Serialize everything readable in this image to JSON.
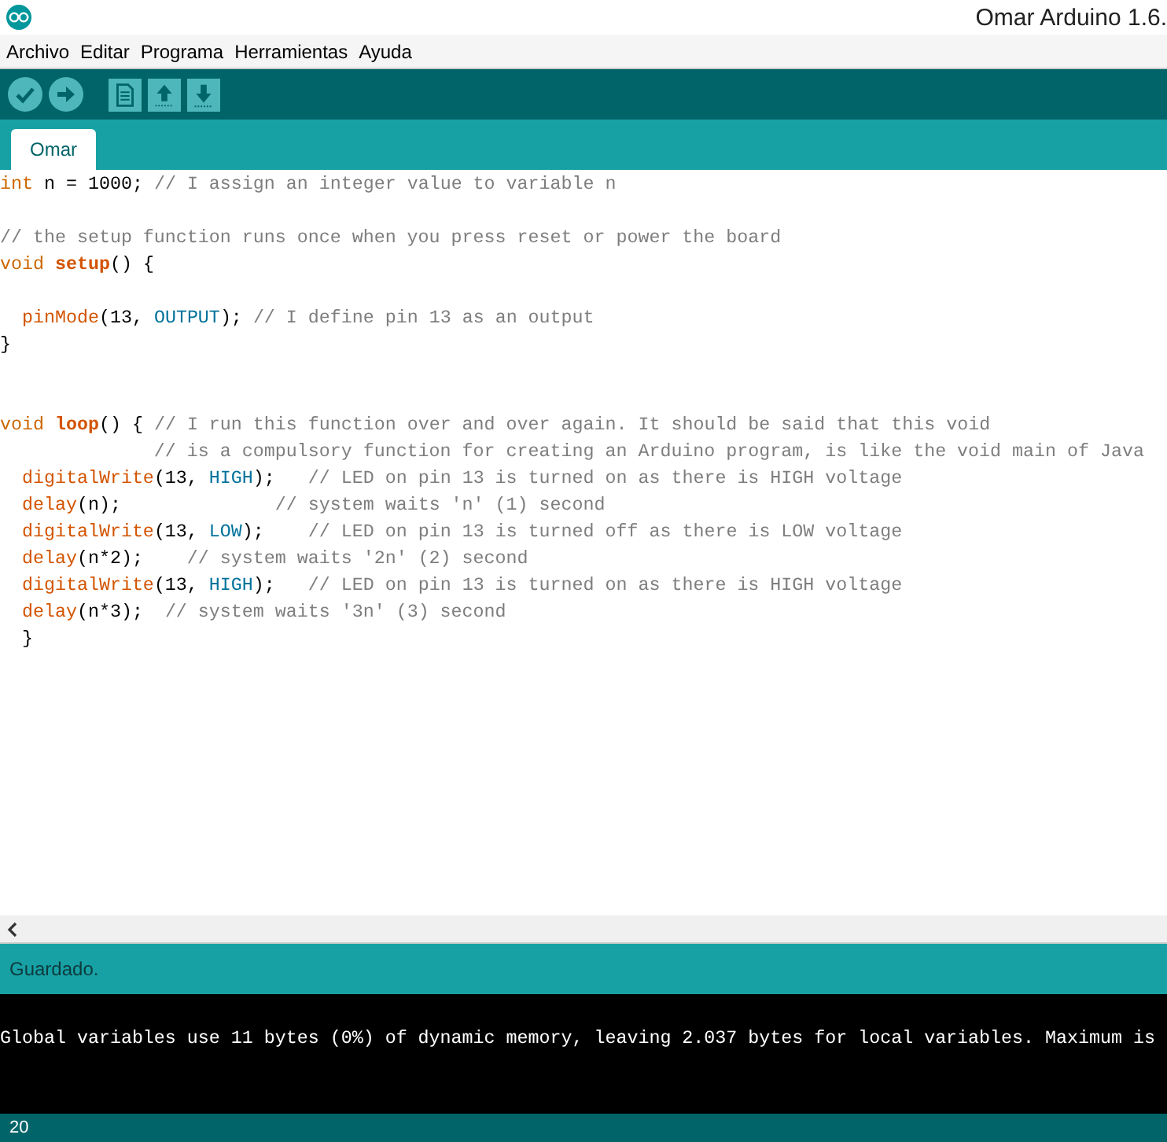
{
  "window": {
    "title": "Omar Arduino 1.6."
  },
  "menu": [
    {
      "label": "Archivo"
    },
    {
      "label": "Editar"
    },
    {
      "label": "Programa"
    },
    {
      "label": "Herramientas"
    },
    {
      "label": "Ayuda"
    }
  ],
  "tabs": [
    {
      "label": "Omar",
      "selected": true
    }
  ],
  "code": [
    {
      "kind": "code",
      "tokens": [
        {
          "kind": "type",
          "text": "int"
        },
        {
          "kind": "plain",
          "text": " n = 1000; "
        },
        {
          "kind": "comment",
          "text": "// I assign an integer value to variable n"
        }
      ]
    },
    {
      "kind": "blank"
    },
    {
      "kind": "code",
      "tokens": [
        {
          "kind": "comment",
          "text": "// the setup function runs once when you press reset or power the board"
        }
      ]
    },
    {
      "kind": "code",
      "tokens": [
        {
          "kind": "type",
          "text": "void "
        },
        {
          "kind": "func_bold",
          "text": "setup"
        },
        {
          "kind": "plain",
          "text": "() {"
        }
      ]
    },
    {
      "kind": "blank"
    },
    {
      "kind": "code",
      "tokens": [
        {
          "kind": "func",
          "text": "  pinMode"
        },
        {
          "kind": "plain",
          "text": "(13, "
        },
        {
          "kind": "const",
          "text": "OUTPUT"
        },
        {
          "kind": "plain",
          "text": "); "
        },
        {
          "kind": "comment",
          "text": "// I define pin 13 as an output"
        }
      ]
    },
    {
      "kind": "code",
      "tokens": [
        {
          "kind": "plain",
          "text": "}"
        }
      ]
    },
    {
      "kind": "blank"
    },
    {
      "kind": "blank"
    },
    {
      "kind": "code",
      "tokens": [
        {
          "kind": "type",
          "text": "void "
        },
        {
          "kind": "func_bold",
          "text": "loop"
        },
        {
          "kind": "plain",
          "text": "() { "
        },
        {
          "kind": "comment",
          "text": "// I run this function over and over again. It should be said that this void"
        }
      ]
    },
    {
      "kind": "code",
      "tokens": [
        {
          "kind": "comment",
          "text": "              // is a compulsory function for creating an Arduino program, is like the void main of Java"
        }
      ]
    },
    {
      "kind": "code",
      "tokens": [
        {
          "kind": "func",
          "text": "  digitalWrite"
        },
        {
          "kind": "plain",
          "text": "(13, "
        },
        {
          "kind": "const",
          "text": "HIGH"
        },
        {
          "kind": "plain",
          "text": ");   "
        },
        {
          "kind": "comment",
          "text": "// LED on pin 13 is turned on as there is HIGH voltage"
        }
      ]
    },
    {
      "kind": "code",
      "tokens": [
        {
          "kind": "func",
          "text": "  delay"
        },
        {
          "kind": "plain",
          "text": "(n);              "
        },
        {
          "kind": "comment",
          "text": "// system waits 'n' (1) second"
        }
      ]
    },
    {
      "kind": "code",
      "tokens": [
        {
          "kind": "func",
          "text": "  digitalWrite"
        },
        {
          "kind": "plain",
          "text": "(13, "
        },
        {
          "kind": "const",
          "text": "LOW"
        },
        {
          "kind": "plain",
          "text": ");    "
        },
        {
          "kind": "comment",
          "text": "// LED on pin 13 is turned off as there is LOW voltage"
        }
      ]
    },
    {
      "kind": "code",
      "tokens": [
        {
          "kind": "func",
          "text": "  delay"
        },
        {
          "kind": "plain",
          "text": "(n*2);    "
        },
        {
          "kind": "comment",
          "text": "// system waits '2n' (2) second"
        }
      ]
    },
    {
      "kind": "code",
      "tokens": [
        {
          "kind": "func",
          "text": "  digitalWrite"
        },
        {
          "kind": "plain",
          "text": "(13, "
        },
        {
          "kind": "const",
          "text": "HIGH"
        },
        {
          "kind": "plain",
          "text": ");   "
        },
        {
          "kind": "comment",
          "text": "// LED on pin 13 is turned on as there is HIGH voltage"
        }
      ]
    },
    {
      "kind": "code",
      "tokens": [
        {
          "kind": "func",
          "text": "  delay"
        },
        {
          "kind": "plain",
          "text": "(n*3);  "
        },
        {
          "kind": "comment",
          "text": "// system waits '3n' (3) second"
        }
      ]
    },
    {
      "kind": "code",
      "tokens": [
        {
          "kind": "plain",
          "text": "  }"
        }
      ]
    }
  ],
  "status_bar": {
    "message": "Guardado."
  },
  "console": {
    "lines": [
      "Global variables use 11 bytes (0%) of dynamic memory, leaving 2.037 bytes for local variables. Maximum is"
    ]
  },
  "footer": {
    "line_number": "20"
  }
}
